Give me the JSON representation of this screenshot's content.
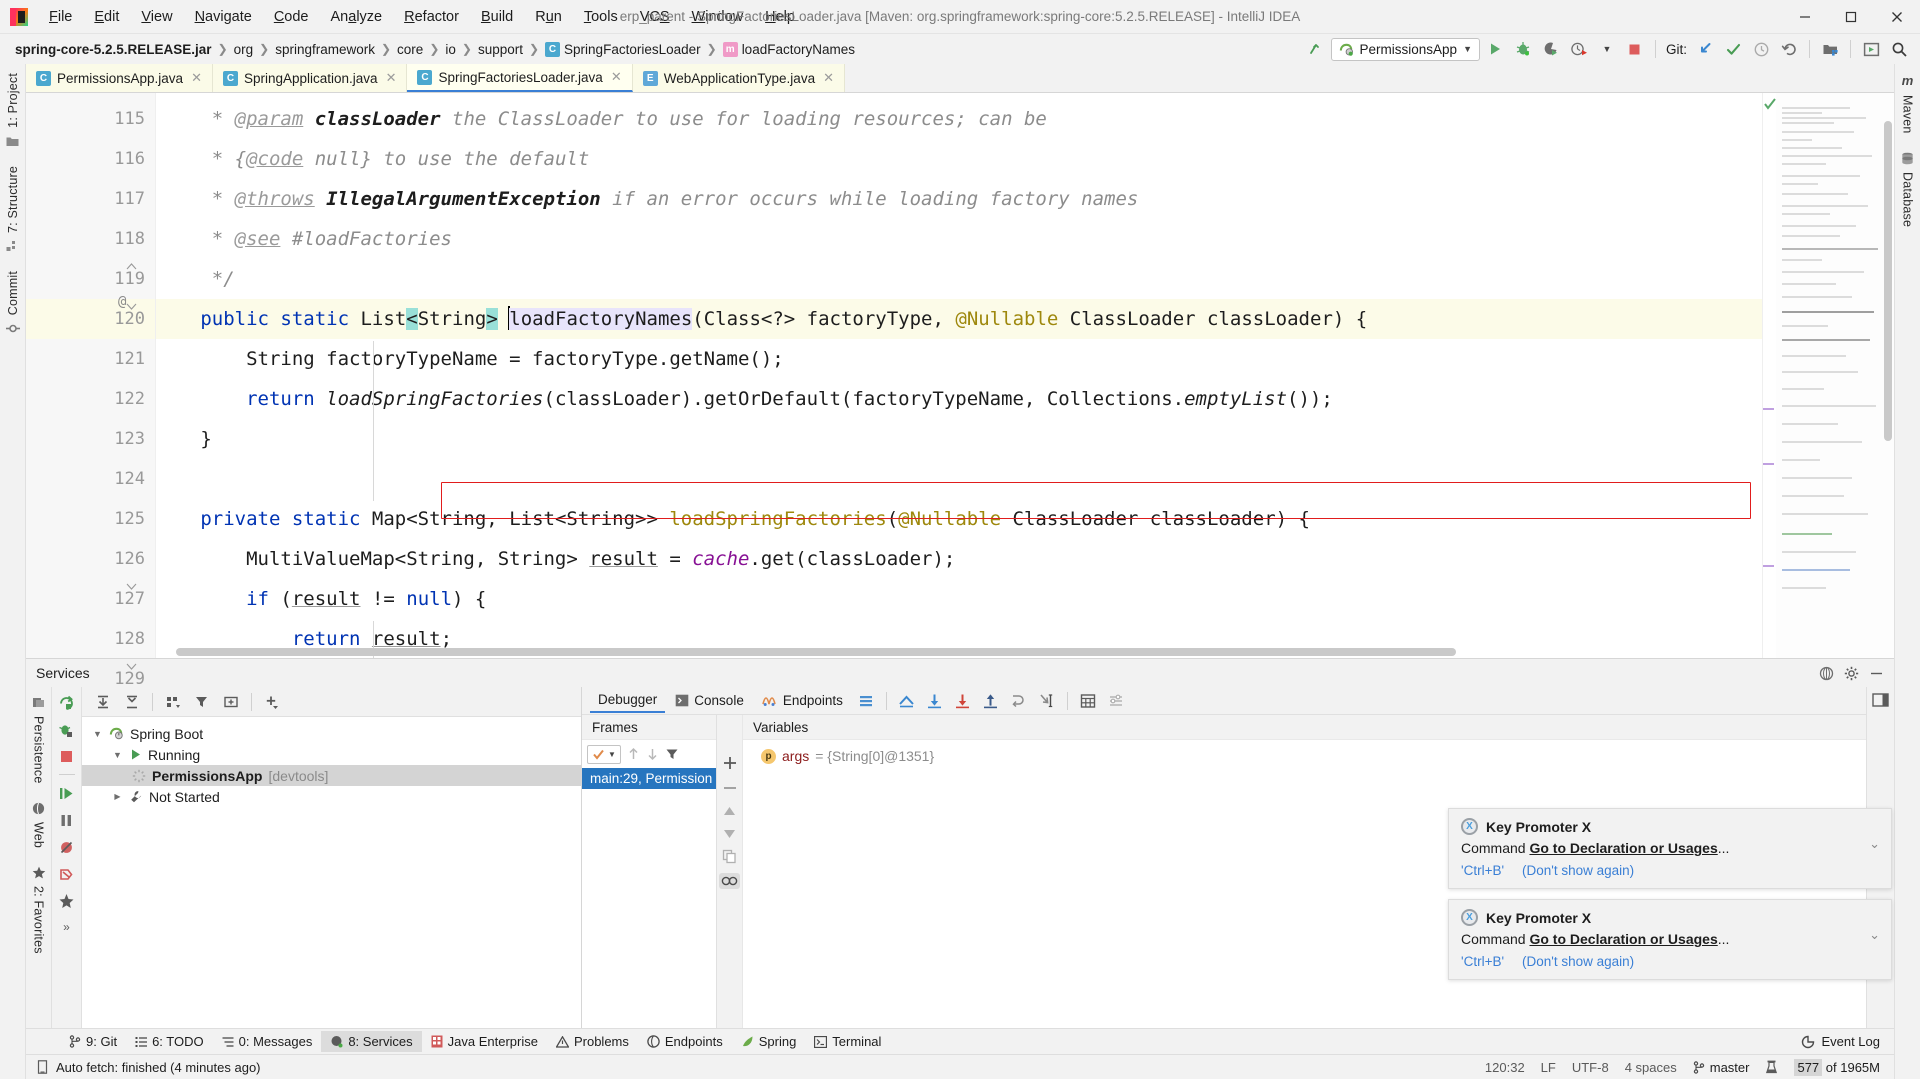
{
  "window": {
    "title": "erp_parent - SpringFactoriesLoader.java [Maven: org.springframework:spring-core:5.2.5.RELEASE] - IntelliJ IDEA",
    "minimize": "–",
    "maximize": "❐",
    "close": "✕"
  },
  "menu": [
    {
      "label": "File",
      "mnemonic": "F"
    },
    {
      "label": "Edit",
      "mnemonic": "E"
    },
    {
      "label": "View",
      "mnemonic": "V"
    },
    {
      "label": "Navigate",
      "mnemonic": "N"
    },
    {
      "label": "Code",
      "mnemonic": "C"
    },
    {
      "label": "Analyze",
      "mnemonic": "A"
    },
    {
      "label": "Refactor",
      "mnemonic": "R"
    },
    {
      "label": "Build",
      "mnemonic": "B"
    },
    {
      "label": "Run",
      "mnemonic": "u"
    },
    {
      "label": "Tools",
      "mnemonic": "T"
    },
    {
      "label": "VCS",
      "mnemonic": "S"
    },
    {
      "label": "Window",
      "mnemonic": "W"
    },
    {
      "label": "Help",
      "mnemonic": "H"
    }
  ],
  "breadcrumbs": [
    {
      "label": "spring-core-5.2.5.RELEASE.jar",
      "bold": true,
      "icon": ""
    },
    {
      "label": "org",
      "bold": false,
      "icon": ""
    },
    {
      "label": "springframework",
      "bold": false,
      "icon": ""
    },
    {
      "label": "core",
      "bold": false,
      "icon": ""
    },
    {
      "label": "io",
      "bold": false,
      "icon": ""
    },
    {
      "label": "support",
      "bold": false,
      "icon": ""
    },
    {
      "label": "SpringFactoriesLoader",
      "bold": false,
      "icon": "class-icon"
    },
    {
      "label": "loadFactoryNames",
      "bold": false,
      "icon": "method-icon"
    }
  ],
  "toolbar": {
    "run_config": "PermissionsApp",
    "run_config_dropdown": "▼",
    "git_label": "Git:",
    "icons": [
      "build-icon",
      "run-icon",
      "debug-icon",
      "run-coverage-icon",
      "profiler-icon",
      "stop-icon",
      "update-project-icon",
      "commit-icon",
      "history-icon",
      "rollback-icon",
      "search-everywhere-icon"
    ]
  },
  "left_tool_tabs": [
    {
      "label": "1: Project",
      "icon": "project-icon"
    },
    {
      "label": "7: Structure",
      "icon": "structure-icon"
    },
    {
      "label": "Commit",
      "icon": "commit-icon"
    }
  ],
  "left_tool_tabs_bottom": [
    {
      "label": "Persistence",
      "icon": "persistence-icon"
    },
    {
      "label": "Web",
      "icon": "web-icon"
    },
    {
      "label": "2: Favorites",
      "icon": "favorites-star-icon"
    }
  ],
  "right_tool_tabs": [
    {
      "label": "Maven",
      "icon": "maven-icon"
    },
    {
      "label": "Database",
      "icon": "database-icon"
    }
  ],
  "editor_tabs": [
    {
      "label": "PermissionsApp.java",
      "icon": "class-icon",
      "active": false
    },
    {
      "label": "SpringApplication.java",
      "icon": "class-icon",
      "active": false
    },
    {
      "label": "SpringFactoriesLoader.java",
      "icon": "class-icon",
      "active": true
    },
    {
      "label": "WebApplicationType.java",
      "icon": "enum-icon",
      "active": false
    }
  ],
  "editor": {
    "first_line": 115,
    "lines": [
      {
        "num": 115,
        "text": " * @param classLoader the ClassLoader to use for loading resources; can be"
      },
      {
        "num": 116,
        "text": " * {@code null} to use the default"
      },
      {
        "num": 117,
        "text": " * @throws IllegalArgumentException if an error occurs while loading factory names"
      },
      {
        "num": 118,
        "text": " * @see #loadFactories"
      },
      {
        "num": 119,
        "text": " */"
      },
      {
        "num": 120,
        "text": "public static List<String> loadFactoryNames(Class<?> factoryType, @Nullable ClassLoader classLoader) {",
        "gutter_mark": "@",
        "current": true
      },
      {
        "num": 121,
        "text": "    String factoryTypeName = factoryType.getName();"
      },
      {
        "num": 122,
        "text": "    return loadSpringFactories(classLoader).getOrDefault(factoryTypeName, Collections.emptyList());",
        "error_box": true
      },
      {
        "num": 123,
        "text": "}"
      },
      {
        "num": 124,
        "text": ""
      },
      {
        "num": 125,
        "text": "private static Map<String, List<String>> loadSpringFactories(@Nullable ClassLoader classLoader) {"
      },
      {
        "num": 126,
        "text": "    MultiValueMap<String, String> result = cache.get(classLoader);"
      },
      {
        "num": 127,
        "text": "    if (result != null) {"
      },
      {
        "num": 128,
        "text": "        return result;"
      },
      {
        "num": 129,
        "text": "    }"
      }
    ]
  },
  "bottom_panel": {
    "title": "Services",
    "services_tree": [
      {
        "label": "Spring Boot",
        "depth": 0,
        "twisty": "▼",
        "icon": "spring-boot-icon",
        "selected": false
      },
      {
        "label": "Running",
        "depth": 1,
        "twisty": "▼",
        "icon": "run-green-icon",
        "selected": false
      },
      {
        "label": "PermissionsApp",
        "suffix": "[devtools]",
        "depth": 2,
        "twisty": "",
        "icon": "spinner-icon",
        "selected": true
      },
      {
        "label": "Not Started",
        "depth": 1,
        "twisty": "▶",
        "icon": "wrench-icon",
        "selected": false
      }
    ],
    "debugger_tabs": [
      {
        "label": "Debugger",
        "icon": "",
        "active": true
      },
      {
        "label": "Console",
        "icon": "console-icon",
        "active": false
      },
      {
        "label": "Endpoints",
        "icon": "endpoints-icon",
        "active": false
      }
    ],
    "debug_actions": [
      "show-execution-point-icon",
      "step-over-icon",
      "step-into-icon",
      "force-step-into-icon",
      "step-out-icon",
      "drop-frame-icon",
      "run-to-cursor-icon",
      "evaluate-expression-icon",
      "settings-icon"
    ],
    "frames_header": "Frames",
    "variables_header": "Variables",
    "frame_selected": "main:29, Permission",
    "variables": [
      {
        "badge": "p",
        "name": "args",
        "value": "= {String[0]@1351}"
      }
    ]
  },
  "notifications": [
    {
      "title": "Key Promoter X",
      "command_prefix": "Command ",
      "command_name": "Go to Declaration or Usages",
      "command_suffix": "...",
      "shortcut": "'Ctrl+B'",
      "dismiss": "(Don't show again)",
      "chevron": "⌄"
    },
    {
      "title": "Key Promoter X",
      "command_prefix": "Command ",
      "command_name": "Go to Declaration or Usages",
      "command_suffix": "...",
      "shortcut": "'Ctrl+B'",
      "dismiss": "(Don't show again)",
      "chevron": "⌄"
    }
  ],
  "tool_window_bar": [
    {
      "label": "9: Git",
      "mnemonic": "9",
      "icon": "git-branch-icon",
      "active": false
    },
    {
      "label": "6: TODO",
      "mnemonic": "6",
      "icon": "todo-icon",
      "active": false
    },
    {
      "label": "0: Messages",
      "mnemonic": "0",
      "icon": "messages-icon",
      "active": false
    },
    {
      "label": "8: Services",
      "mnemonic": "8",
      "icon": "services-icon",
      "active": true
    },
    {
      "label": "Java Enterprise",
      "mnemonic": "",
      "icon": "java-enterprise-icon",
      "active": false
    },
    {
      "label": "Problems",
      "mnemonic": "",
      "icon": "problems-warning-icon",
      "active": false
    },
    {
      "label": "Endpoints",
      "mnemonic": "",
      "icon": "endpoints-icon",
      "active": false
    },
    {
      "label": "Spring",
      "mnemonic": "",
      "icon": "spring-leaf-icon",
      "active": false
    },
    {
      "label": "Terminal",
      "mnemonic": "",
      "icon": "terminal-icon",
      "active": false
    }
  ],
  "event_log": {
    "label": "Event Log",
    "icon": "event-log-icon"
  },
  "statusbar": {
    "message": "Auto fetch: finished (4 minutes ago)",
    "message_icon": "notification-icon",
    "caret": "120:32",
    "line_sep": "LF",
    "encoding": "UTF-8",
    "indent": "4 spaces",
    "branch": "master",
    "branch_icon": "git-branch-icon",
    "inspection_icon": "inspector-icon",
    "memory_used": "577",
    "memory_total": " of 1965M"
  }
}
